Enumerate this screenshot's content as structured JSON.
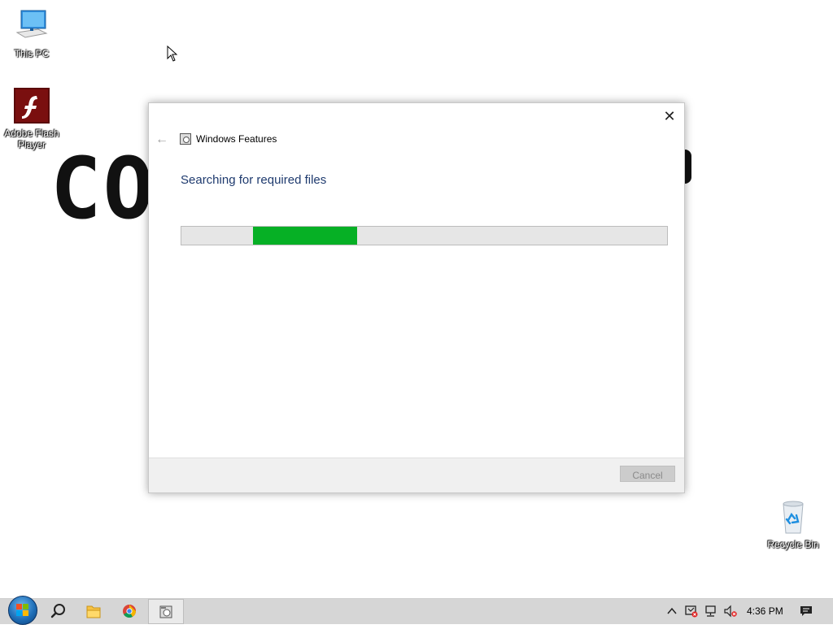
{
  "desktop": {
    "icons": [
      {
        "label": "This PC"
      },
      {
        "label": "Adobe Flash Player"
      },
      {
        "label": "Recycle Bin"
      }
    ],
    "wallpaper_text": "CO"
  },
  "dialog": {
    "title": "Windows Features",
    "heading": "Searching for required files",
    "progress": {
      "start_fraction": 0.148,
      "end_fraction": 0.361,
      "color": "#06b025"
    },
    "cancel_label": "Cancel",
    "close_glyph": "✕",
    "back_glyph": "←"
  },
  "taskbar": {
    "apps": [
      {
        "icon": "search-icon"
      },
      {
        "icon": "file-explorer-icon"
      },
      {
        "icon": "chrome-icon"
      },
      {
        "icon": "windows-features-icon",
        "active": true
      }
    ],
    "tray": {
      "chevron": "^",
      "clock": "4:36 PM"
    }
  },
  "colors": {
    "heading": "#1e3a6e",
    "progress_fill": "#06b025",
    "taskbar": "#d6d6d6"
  }
}
